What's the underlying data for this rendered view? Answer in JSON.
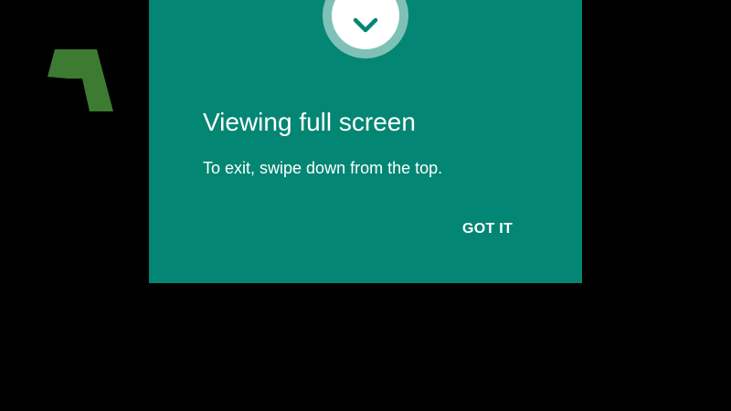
{
  "dialog": {
    "title": "Viewing full screen",
    "message": "To exit, swipe down from the top.",
    "confirm_label": "GOT IT",
    "badge_icon": "chevron-down-icon",
    "background_color": "#038673",
    "badge_ring_color": "#7fc1b6",
    "icon_color": "#038673"
  },
  "background": {
    "color": "#000000",
    "logo_icon": "green-triangle-logo",
    "logo_color": "#3d7a32"
  }
}
